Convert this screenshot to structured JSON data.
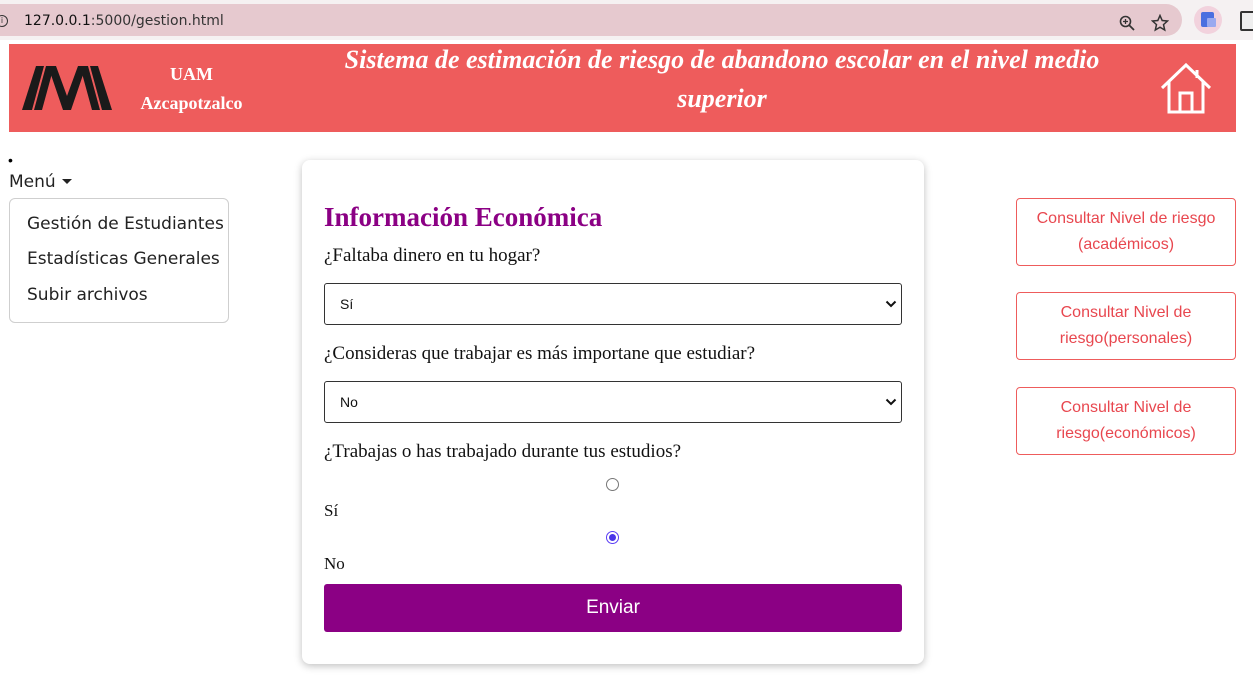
{
  "browser": {
    "url_host": "127.0.0.1",
    "url_rest": ":5000/gestion.html"
  },
  "header": {
    "org_line1": "UAM",
    "org_line2": "Azcapotzalco",
    "title": "Sistema de estimación de riesgo de abandono escolar en el nivel medio superior"
  },
  "sidebar": {
    "bullet": "•",
    "menu_label": "Menú",
    "items": [
      {
        "label": "Gestión de Estudiantes"
      },
      {
        "label": "Estadísticas Generales"
      },
      {
        "label": "Subir archivos"
      }
    ]
  },
  "form": {
    "title": "Información Económica",
    "q1": {
      "label": "¿Faltaba dinero en tu hogar?",
      "value": "Sí"
    },
    "q2": {
      "label": "¿Consideras que trabajar es más importane que estudiar?",
      "value": "No"
    },
    "q3": {
      "label": "¿Trabajas o has trabajado durante tus estudios?",
      "options": [
        {
          "label": "Sí",
          "checked": false
        },
        {
          "label": "No",
          "checked": true
        }
      ]
    },
    "submit_label": "Enviar"
  },
  "right_buttons": [
    {
      "label": "Consultar Nivel de riesgo (académicos)"
    },
    {
      "label": "Consultar Nivel de riesgo(personales)"
    },
    {
      "label": "Consultar Nivel de riesgo(económicos)"
    }
  ],
  "colors": {
    "header_bg": "#ee5c5c",
    "accent_purple": "#8b0084",
    "button_border": "#ee5c5c"
  }
}
